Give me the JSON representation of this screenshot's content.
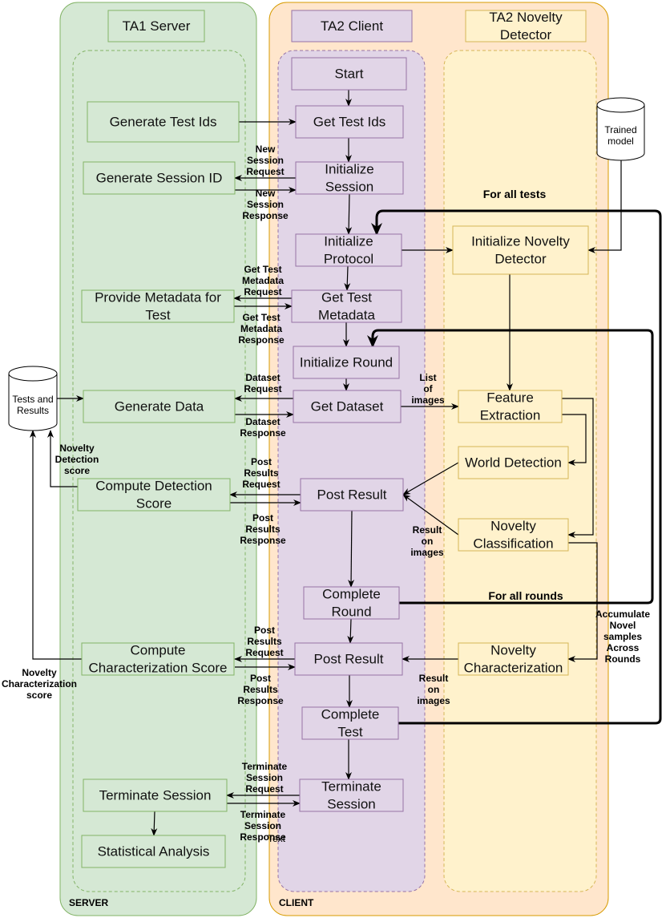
{
  "colors": {
    "server_fill": "#d5e8d4",
    "server_stroke": "#82b366",
    "client_fill": "#ffe6cc",
    "client_stroke": "#d79b00",
    "ta2_fill": "#e1d5e7",
    "ta2_stroke": "#9673a6",
    "detector_fill": "#fff2cc",
    "detector_stroke": "#d6b656"
  },
  "headers": {
    "server": [
      "TA1 Server"
    ],
    "client": [
      "TA2 Client"
    ],
    "detector": [
      "TA2 Novelty",
      "Detector"
    ]
  },
  "zone_labels": {
    "server": "SERVER",
    "client": "CLIENT"
  },
  "nodes": {
    "start": [
      "Start"
    ],
    "get_test_ids": [
      "Get Test Ids"
    ],
    "init_session": [
      "Initialize",
      "Session"
    ],
    "init_protocol": [
      "Initialize",
      "Protocol"
    ],
    "get_test_metadata": [
      "Get Test",
      "Metadata"
    ],
    "init_round": [
      "Initialize Round"
    ],
    "get_dataset": [
      "Get Dataset"
    ],
    "post_result_1": [
      "Post Result"
    ],
    "complete_round": [
      "Complete",
      "Round"
    ],
    "post_result_2": [
      "Post Result"
    ],
    "complete_test": [
      "Complete",
      "Test"
    ],
    "terminate_session_client": [
      "Terminate",
      "Session"
    ],
    "generate_test_ids": [
      "Generate Test Ids"
    ],
    "generate_session_id": [
      "Generate Session ID"
    ],
    "provide_metadata": [
      "Provide Metadata for",
      "Test"
    ],
    "generate_data": [
      "Generate Data"
    ],
    "compute_detection_score": [
      "Compute Detection",
      "Score"
    ],
    "compute_characterization_score": [
      "Compute",
      "Characterization Score"
    ],
    "terminate_session_server": [
      "Terminate Session"
    ],
    "statistical_analysis": [
      "Statistical Analysis"
    ],
    "init_novelty_detector": [
      "Initialize Novelty",
      "Detector"
    ],
    "feature_extraction": [
      "Feature",
      "Extraction"
    ],
    "world_detection": [
      "World Detection"
    ],
    "novelty_classification": [
      "Novelty",
      "Classification"
    ],
    "novelty_characterization": [
      "Novelty",
      "Characterization"
    ]
  },
  "databases": {
    "trained_model": [
      "Trained",
      "model"
    ],
    "tests_and_results": [
      "Tests and",
      "Results"
    ]
  },
  "edge_labels": {
    "new_session_request": [
      "New",
      "Session",
      "Request"
    ],
    "new_session_response": [
      "New",
      "Session",
      "Response"
    ],
    "get_test_metadata_request": [
      "Get Test",
      "Metadata",
      "Request"
    ],
    "get_test_metadata_response": [
      "Get Test",
      "Metadata",
      "Response"
    ],
    "dataset_request": [
      "Dataset",
      "Request"
    ],
    "dataset_response": [
      "Dataset",
      "Response"
    ],
    "list_of_images": [
      "List",
      "of",
      "images"
    ],
    "post_results_request_1": [
      "Post",
      "Results",
      "Request"
    ],
    "post_results_response_1": [
      "Post",
      "Results",
      "Response"
    ],
    "result_on_images_1": [
      "Result",
      "on",
      "images"
    ],
    "novelty_detection_score": [
      "Novelty",
      "Detection",
      "score"
    ],
    "post_results_request_2": [
      "Post",
      "Results",
      "Request"
    ],
    "post_results_response_2": [
      "Post",
      "Results",
      "Response"
    ],
    "result_on_images_2": [
      "Result",
      "on",
      "images"
    ],
    "novelty_characterization_score": [
      "Novelty",
      "Characterization",
      "score"
    ],
    "accumulate": [
      "Accumulate",
      "Novel",
      "samples",
      "Across",
      "Rounds"
    ],
    "terminate_session_request": [
      "Terminate",
      "Session",
      "Request"
    ],
    "terminate_session_response": [
      "Terminate",
      "Session",
      "Response"
    ],
    "stray_text": [
      "Text"
    ]
  },
  "loop_labels": {
    "for_all_tests": "For all tests",
    "for_all_rounds": "For all rounds"
  }
}
